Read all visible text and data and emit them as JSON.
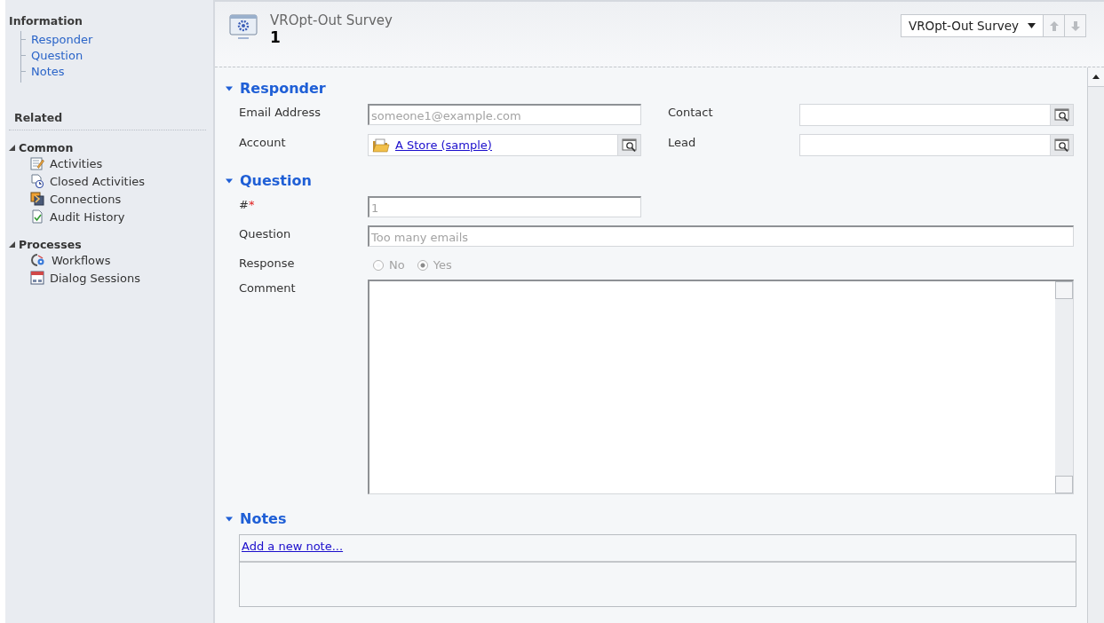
{
  "sidebar": {
    "information": {
      "title": "Information",
      "items": [
        {
          "label": "Responder"
        },
        {
          "label": "Question"
        },
        {
          "label": "Notes"
        }
      ]
    },
    "related": {
      "title": "Related",
      "groups": [
        {
          "title": "Common",
          "expanded": true,
          "items": [
            {
              "label": "Activities"
            },
            {
              "label": "Closed Activities"
            },
            {
              "label": "Connections"
            },
            {
              "label": "Audit History"
            }
          ]
        },
        {
          "title": "Processes",
          "expanded": true,
          "items": [
            {
              "label": "Workflows"
            },
            {
              "label": "Dialog Sessions"
            }
          ]
        }
      ]
    }
  },
  "header": {
    "entity": "VROpt-Out Survey",
    "record": "1",
    "form_selector": "VROpt-Out Survey"
  },
  "sections": [
    {
      "title": "Responder",
      "expanded": true,
      "rows": [
        [
          {
            "kind": "text",
            "label": "Email Address",
            "value": "someone1@example.com",
            "disabled": true
          },
          {
            "kind": "lookup",
            "label": "Contact"
          }
        ],
        [
          {
            "kind": "lookup",
            "label": "Account",
            "value": "A Store (sample)"
          },
          {
            "kind": "lookup",
            "label": "Lead"
          }
        ]
      ]
    },
    {
      "title": "Question",
      "expanded": true,
      "rows": [
        [
          {
            "kind": "text",
            "label": "#",
            "required_mark": "*",
            "value": "1",
            "disabled": true
          }
        ],
        [
          {
            "kind": "wide",
            "label": "Question",
            "value": "Too many emails",
            "disabled": true
          }
        ],
        [
          {
            "kind": "radio",
            "label": "Response",
            "disabled": true,
            "options": [
              {
                "label": "No",
                "selected": false
              },
              {
                "label": "Yes",
                "selected": true
              }
            ]
          }
        ],
        [
          {
            "kind": "textarea",
            "label": "Comment"
          }
        ]
      ]
    },
    {
      "title": "Notes",
      "expanded": true,
      "notes": {
        "link": "Add a new note..."
      }
    }
  ]
}
